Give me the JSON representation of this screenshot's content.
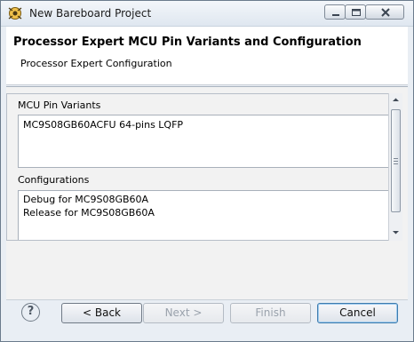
{
  "window": {
    "title": "New Bareboard Project"
  },
  "header": {
    "title": "Processor Expert MCU Pin Variants and Configuration",
    "subtitle": "Processor Expert Configuration"
  },
  "pin_variants": {
    "label": "MCU Pin Variants",
    "items": [
      "MC9S08GB60ACFU 64-pins LQFP"
    ]
  },
  "configurations": {
    "label": "Configurations",
    "items": [
      "Debug for MC9S08GB60A",
      "Release for MC9S08GB60A"
    ]
  },
  "footer": {
    "help_glyph": "?",
    "back_label": "< Back",
    "next_label": "Next >",
    "finish_label": "Finish",
    "cancel_label": "Cancel"
  }
}
